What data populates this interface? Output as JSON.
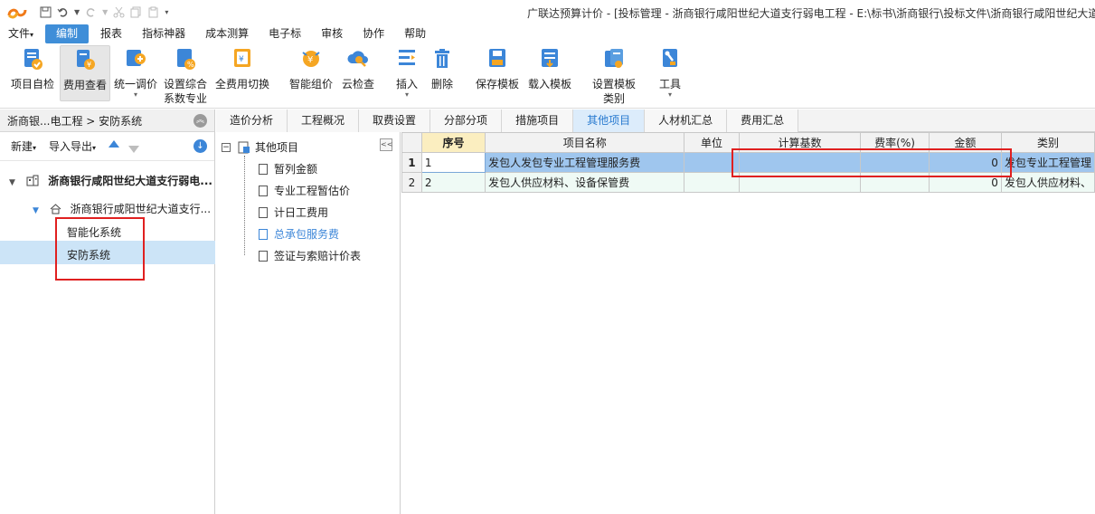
{
  "title_bar": {
    "title": "广联达预算计价 - [投标管理 - 浙商银行咸阳世纪大道支行弱电工程 - E:\\标书\\浙商银行\\投标文件\\浙商银行咸阳世纪大道"
  },
  "menu": {
    "items": [
      "文件",
      "编制",
      "报表",
      "指标神器",
      "成本测算",
      "电子标",
      "审核",
      "协作",
      "帮助"
    ],
    "active": "编制"
  },
  "toolbar": {
    "buttons": [
      {
        "label": "项目自检",
        "label2": ""
      },
      {
        "label": "费用查看",
        "label2": ""
      },
      {
        "label": "统一调价",
        "label2": ""
      },
      {
        "label": "设置综合",
        "label2": "系数专业"
      },
      {
        "label": "全费用切换",
        "label2": ""
      },
      {
        "label": "智能组价",
        "label2": ""
      },
      {
        "label": "云检查",
        "label2": ""
      },
      {
        "label": "插入",
        "label2": ""
      },
      {
        "label": "删除",
        "label2": ""
      },
      {
        "label": "保存模板",
        "label2": ""
      },
      {
        "label": "载入模板",
        "label2": ""
      },
      {
        "label": "设置模板",
        "label2": "类别"
      },
      {
        "label": "工具",
        "label2": ""
      }
    ]
  },
  "left_panel": {
    "breadcrumb": "浙商银...电工程 > 安防系统",
    "new_label": "新建",
    "import_export_label": "导入导出",
    "tree": {
      "project": "浙商银行咸阳世纪大道支行弱电...",
      "unit": "浙商银行咸阳世纪大道支行...",
      "children": [
        "智能化系统",
        "安防系统"
      ]
    }
  },
  "tabs": {
    "items": [
      "造价分析",
      "工程概况",
      "取费设置",
      "分部分项",
      "措施项目",
      "其他项目",
      "人材机汇总",
      "费用汇总"
    ],
    "active": "其他项目"
  },
  "middle_tree": {
    "root": "其他项目",
    "items": [
      "暂列金额",
      "专业工程暂估价",
      "计日工费用",
      "总承包服务费",
      "签证与索赔计价表"
    ],
    "active": "总承包服务费"
  },
  "grid": {
    "headers": [
      "序号",
      "项目名称",
      "单位",
      "计算基数",
      "费率(%)",
      "金额",
      "类别"
    ],
    "rows": [
      {
        "row_num": "1",
        "seq": "1",
        "name": "发包人发包专业工程管理服务费",
        "unit": "",
        "base": "",
        "rate": "",
        "amount": "0",
        "category": "发包专业工程管理"
      },
      {
        "row_num": "2",
        "seq": "2",
        "name": "发包人供应材料、设备保管费",
        "unit": "",
        "base": "",
        "rate": "",
        "amount": "0",
        "category": "发包人供应材料、"
      }
    ]
  },
  "colors": {
    "accent": "#3f8ed8",
    "highlight_box": "#e02020",
    "selected_row": "#9fc6ee"
  }
}
